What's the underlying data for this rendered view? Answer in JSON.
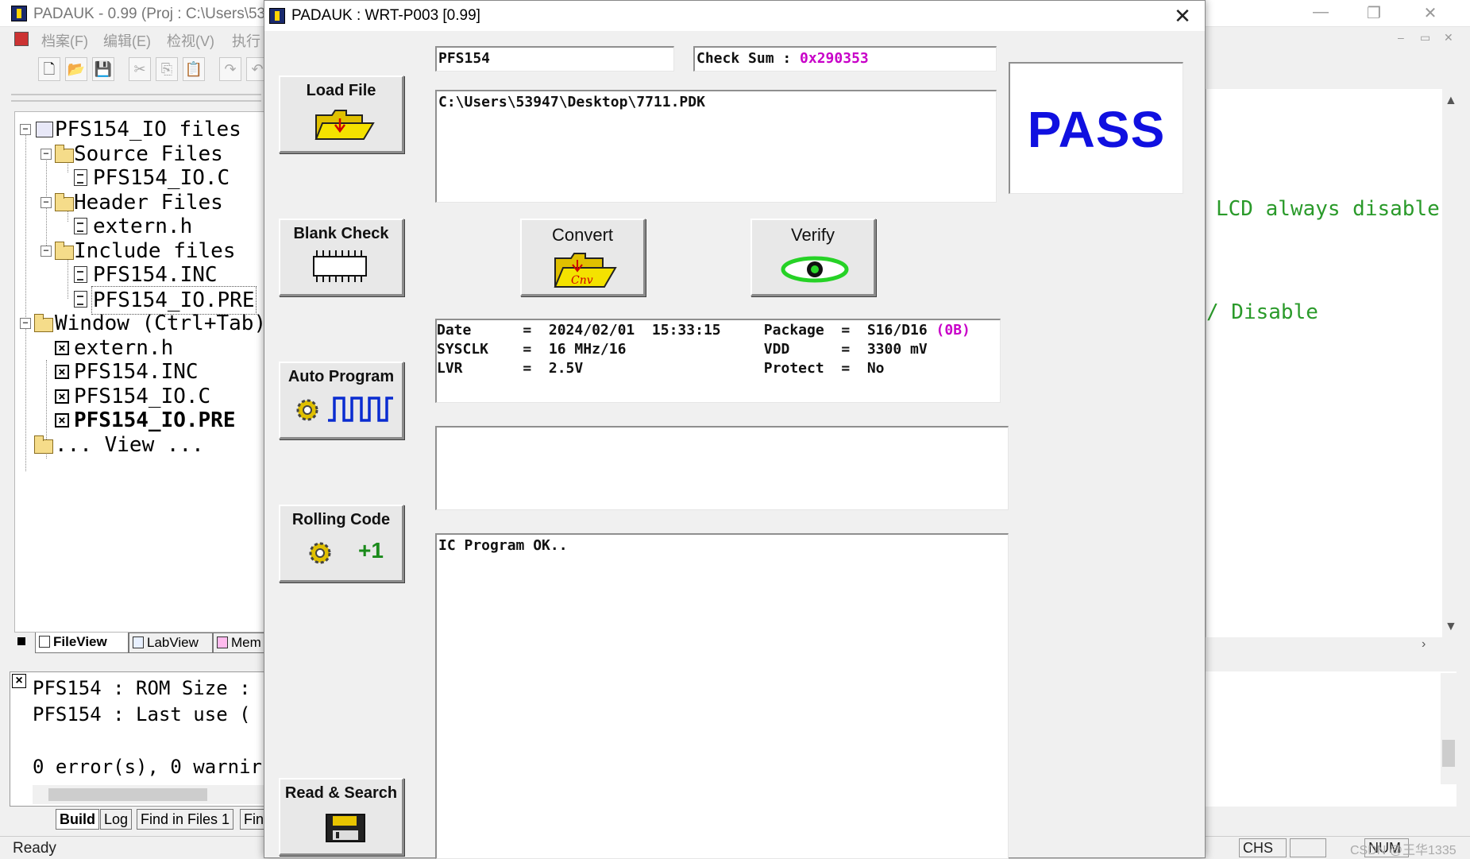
{
  "ide": {
    "title": "PADAUK - 0.99 (Proj : C:\\Users\\53",
    "menu": [
      "档案(F)",
      "编辑(E)",
      "检视(V)",
      "执行"
    ],
    "mdi_controls": [
      "–",
      "▭",
      "✕"
    ],
    "toolbar_icons": [
      "new-file-icon",
      "open-folder-icon",
      "save-icon",
      "cut-icon",
      "copy-icon",
      "paste-icon",
      "redo-icon",
      "undo-icon"
    ],
    "tree": {
      "project": "PFS154_IO files",
      "source_folder": "Source Files",
      "source_file": "PFS154_IO.C",
      "header_folder": "Header Files",
      "header_file": "extern.h",
      "include_folder": "Include files",
      "include_file1": "PFS154.INC",
      "include_file2": "PFS154_IO.PRE",
      "window_group": "Window (Ctrl+Tab)",
      "win1": "extern.h",
      "win2": "PFS154.INC",
      "win3": "PFS154_IO.C",
      "win4": "PFS154_IO.PRE",
      "view": "... View ..."
    },
    "panel_tabs": [
      "FileView",
      "LabView",
      "Mem"
    ],
    "output_lines": [
      "PFS154   : ROM Size :",
      "PFS154   : Last use (",
      "",
      "0 error(s), 0 warnir"
    ],
    "bottom_tabs": [
      "Build",
      "Log",
      "Find in Files 1",
      "Fin"
    ],
    "status": {
      "ready": "Ready",
      "chs": "CHS",
      "num": "NUM",
      "watermark": "CSDN @王华1335"
    },
    "editor_lines": [
      "LCD always disable,",
      "/ Disable"
    ]
  },
  "dialog": {
    "title": "PADAUK : WRT-P003 [0.99]",
    "close": "✕",
    "ic_name": "PFS154",
    "checksum_label": "Check Sum : ",
    "checksum_value": "0x290353",
    "file_path": "C:\\Users\\53947\\Desktop\\7711.PDK",
    "result": "PASS",
    "buttons": {
      "load_file": "Load File",
      "blank_check": "Blank Check",
      "convert": "Convert",
      "verify": "Verify",
      "auto_program": "Auto Program",
      "rolling_code": "Rolling Code",
      "read_search": "Read & Search"
    },
    "info": {
      "date_row": "Date      =  2024/02/01  15:33:15     Package  =  S16/D16 ",
      "package_extra": "(0B)",
      "sysclk_row": "SYSCLK    =  16 MHz/16                VDD      =  3300 mV",
      "lvr_row": "LVR       =  2.5V                     Protect  =  No"
    },
    "message": "IC Program OK..",
    "rolling_plus": "+1",
    "convert_icon_text": "Cnv"
  }
}
